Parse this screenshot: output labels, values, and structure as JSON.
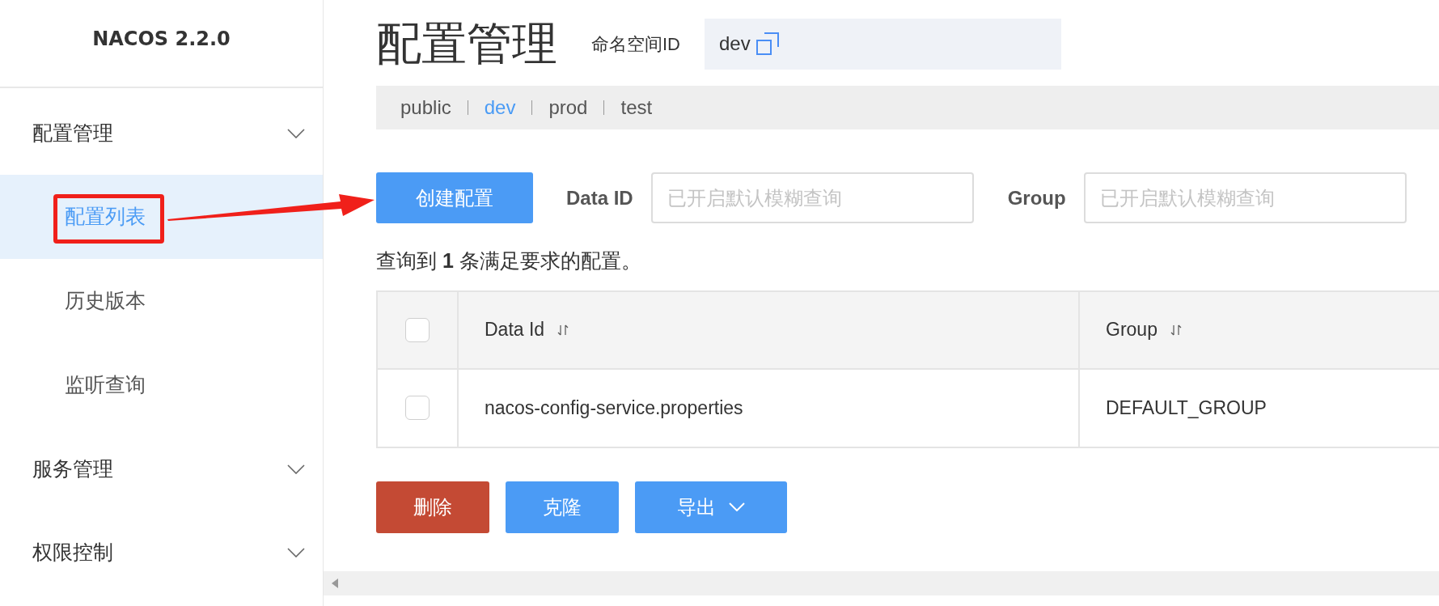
{
  "sidebar": {
    "logo": "NACOS 2.2.0",
    "items": [
      {
        "label": "配置管理",
        "children": [
          {
            "label": "配置列表",
            "selected": true
          },
          {
            "label": "历史版本",
            "selected": false
          },
          {
            "label": "监听查询",
            "selected": false
          }
        ]
      },
      {
        "label": "服务管理"
      },
      {
        "label": "权限控制"
      }
    ]
  },
  "header": {
    "title": "配置管理",
    "namespace_label": "命名空间ID",
    "namespace_value": "dev"
  },
  "namespaces": [
    {
      "label": "public",
      "selected": false
    },
    {
      "label": "dev",
      "selected": true
    },
    {
      "label": "prod",
      "selected": false
    },
    {
      "label": "test",
      "selected": false
    }
  ],
  "toolbar": {
    "create_button": "创建配置",
    "filters": [
      {
        "label": "Data ID",
        "placeholder": "已开启默认模糊查询"
      },
      {
        "label": "Group",
        "placeholder": "已开启默认模糊查询"
      }
    ]
  },
  "result": "查询到 **1** 条满足要求的配置。",
  "table": {
    "select_all_checked": false,
    "columns": [
      {
        "label": "Data Id",
        "sortable": true
      },
      {
        "label": "Group",
        "sortable": true
      }
    ],
    "rows": [
      {
        "checked": false,
        "cells": [
          "nacos-config-service.properties",
          "DEFAULT_GROUP"
        ]
      }
    ]
  },
  "actions": [
    {
      "label": "删除",
      "kind": "danger"
    },
    {
      "label": "克隆",
      "kind": "primary"
    },
    {
      "label": "导出",
      "kind": "dropdown"
    }
  ]
}
